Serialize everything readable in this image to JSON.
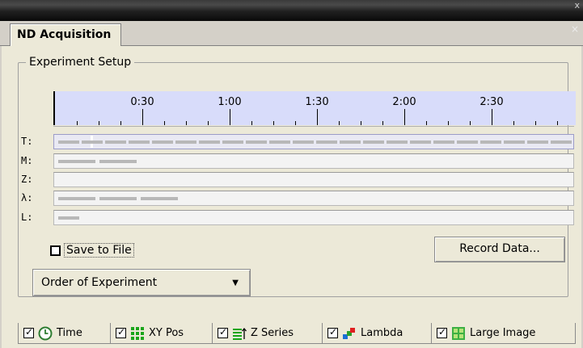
{
  "window": {
    "close_glyph": "x"
  },
  "tab": {
    "title": "ND Acquisition",
    "close_glyph": "×"
  },
  "setup": {
    "legend": "Experiment Setup",
    "timeline": {
      "labels": [
        "0:30",
        "1:00",
        "1:30",
        "2:00",
        "2:30"
      ]
    },
    "rows": [
      {
        "label": "T:",
        "segments": 22
      },
      {
        "label": "M:",
        "segments": 2
      },
      {
        "label": "Z:",
        "segments": 0
      },
      {
        "label": "λ:",
        "segments": 3
      },
      {
        "label": "L:",
        "segments": 1
      }
    ]
  },
  "save_to_file": {
    "label": "Save to File",
    "checked": false
  },
  "record_button": {
    "label": "Record Data..."
  },
  "order_button": {
    "label": "Order of Experiment",
    "arrow": "▼"
  },
  "bottom_tabs": [
    {
      "label": "Time",
      "icon": "clock-icon",
      "checked": true
    },
    {
      "label": "XY Pos",
      "icon": "grid-icon",
      "checked": true
    },
    {
      "label": "Z Series",
      "icon": "z-stack-icon",
      "checked": true
    },
    {
      "label": "Lambda",
      "icon": "lambda-icon",
      "checked": true
    },
    {
      "label": "Large Image",
      "icon": "large-image-icon",
      "checked": true
    }
  ],
  "check_glyph": "✓"
}
